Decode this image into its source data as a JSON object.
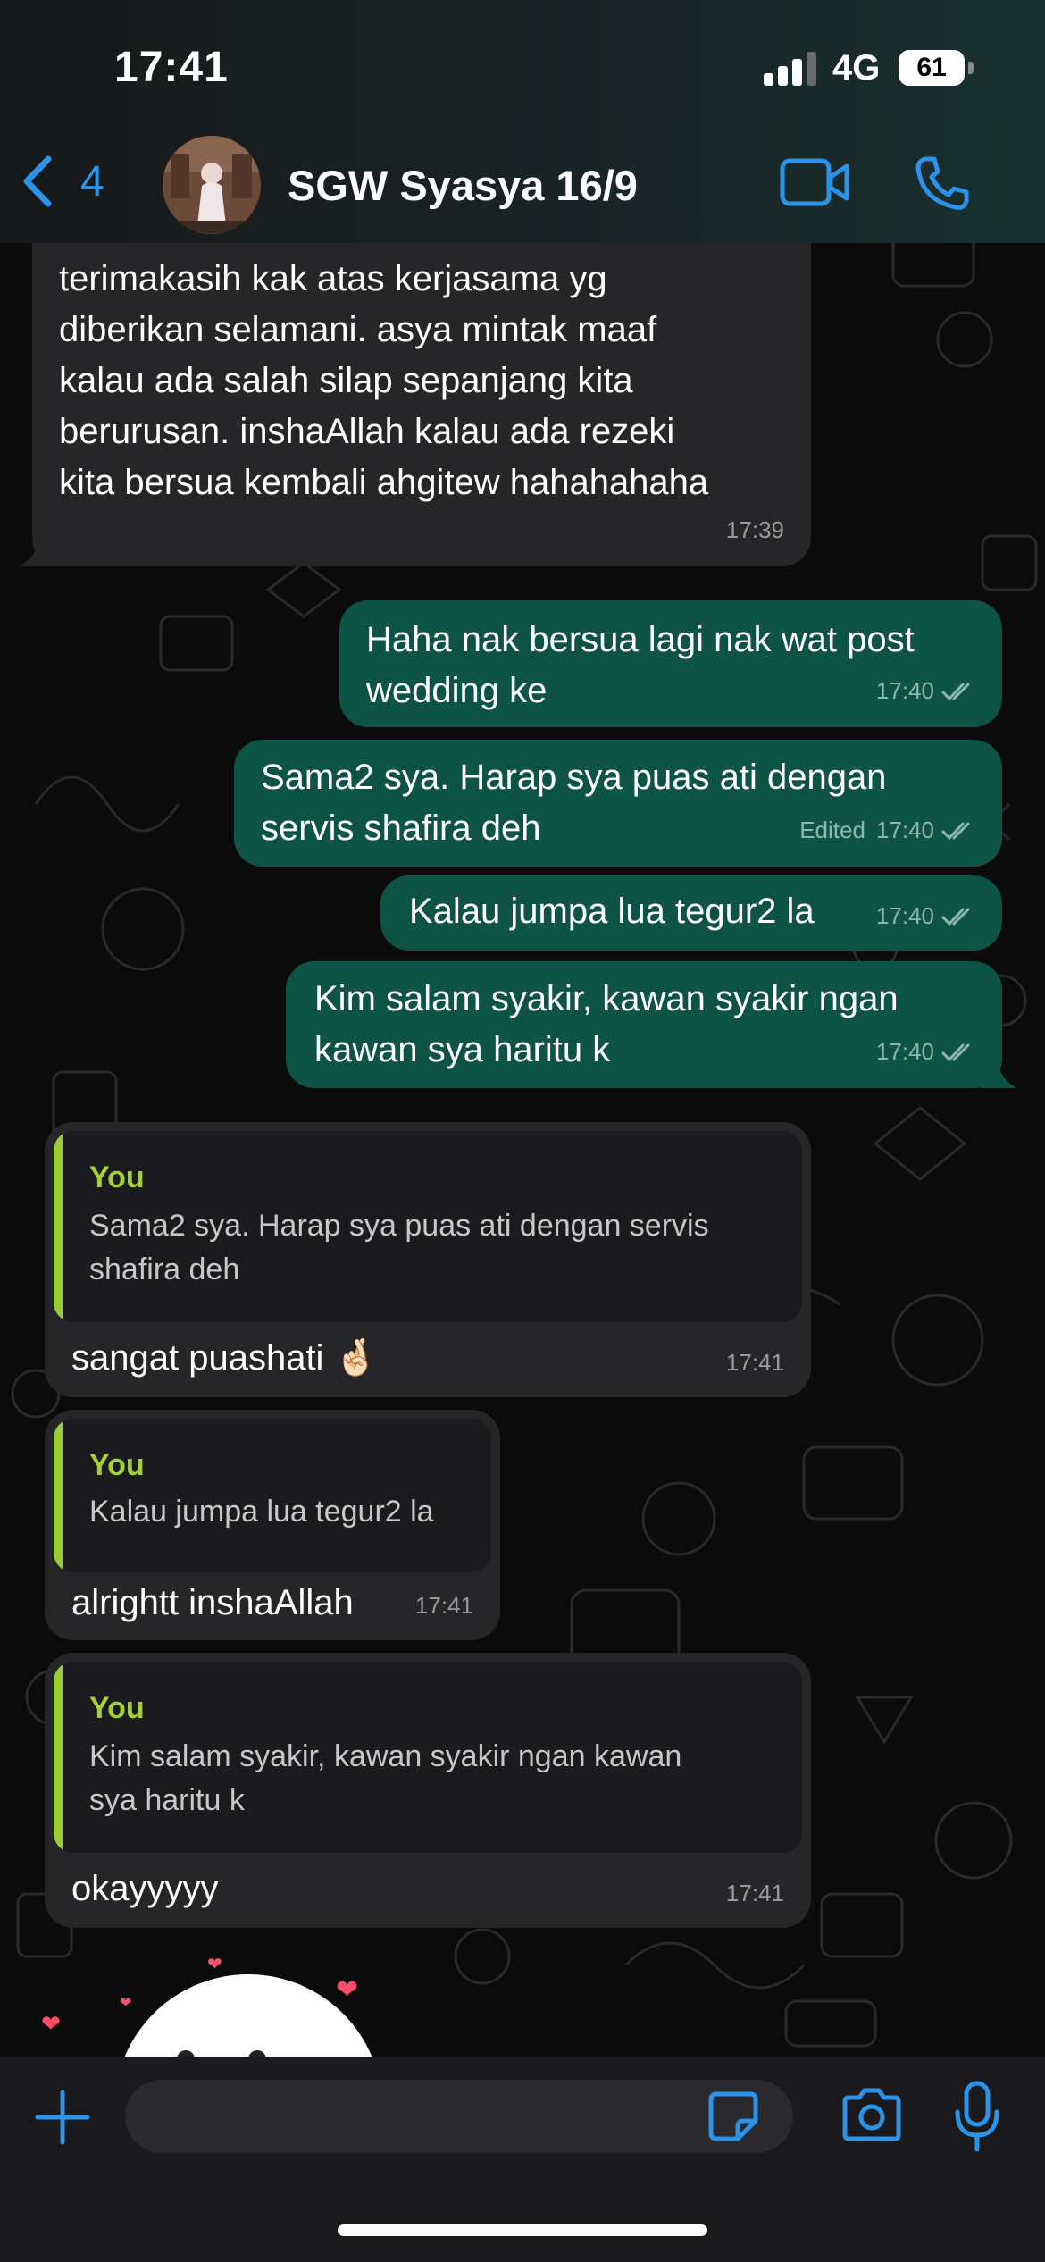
{
  "status_bar": {
    "time": "17:41",
    "network": "4G",
    "battery": "61"
  },
  "header": {
    "back_count": "4",
    "contact_name": "SGW Syasya 16/9"
  },
  "colors": {
    "accent": "#2b93e8",
    "outgoing_bubble": "#0e5446",
    "incoming_bubble": "#262628",
    "quote_author": "#a4d233"
  },
  "messages": [
    {
      "direction": "in",
      "text": "terimakasih kak atas kerjasama yg\ndiberikan selamani. asya mintak maaf\nkalau ada salah silap sepanjang kita\nberurusan. inshaAllah kalau ada rezeki\nkita bersua kembali ahgitew hahahahaha",
      "time": "17:39"
    },
    {
      "direction": "out",
      "text": "Haha nak bersua lagi nak wat post\nwedding ke",
      "time": "17:40",
      "read": true
    },
    {
      "direction": "out",
      "text": "Sama2 sya. Harap sya puas ati dengan\nservis shafira deh",
      "edited_label": "Edited",
      "time": "17:40",
      "read": true
    },
    {
      "direction": "out",
      "text": "Kalau jumpa lua tegur2 la",
      "time": "17:40",
      "read": true
    },
    {
      "direction": "out",
      "text": "Kim salam syakir, kawan syakir ngan\nkawan sya haritu k",
      "time": "17:40",
      "read": true
    },
    {
      "direction": "in",
      "quote_author": "You",
      "quote_text": "Sama2 sya. Harap sya puas ati dengan servis\nshafira deh",
      "text": "sangat puashati 🤞🏻",
      "time": "17:41"
    },
    {
      "direction": "in",
      "quote_author": "You",
      "quote_text": "Kalau jumpa lua tegur2 la",
      "text": "alrightt inshaAllah",
      "time": "17:41"
    },
    {
      "direction": "in",
      "quote_author": "You",
      "quote_text": "Kim salam syakir, kawan syakir ngan kawan\nsya haritu k",
      "text": "okayyyyy",
      "time": "17:41"
    }
  ],
  "input": {
    "placeholder": ""
  },
  "icons": [
    "back-chevron-icon",
    "video-call-icon",
    "phone-icon",
    "plus-icon",
    "sticker-icon",
    "camera-icon",
    "microphone-icon"
  ]
}
